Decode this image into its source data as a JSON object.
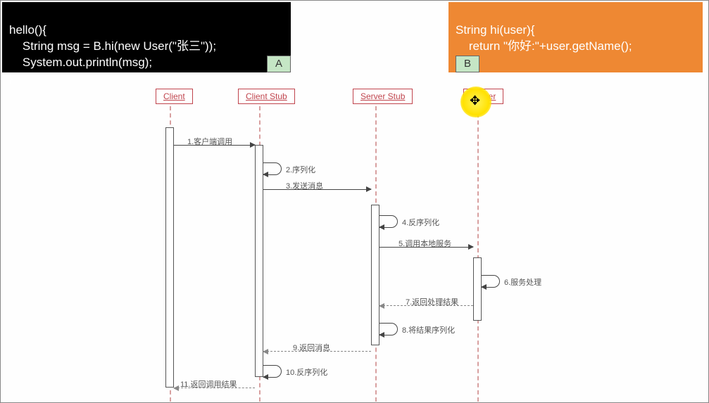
{
  "codeA": {
    "l1": "hello(){",
    "l2": "    String msg = B.hi(new User(\"张三\"));",
    "l3": "    System.out.println(msg);",
    "l4": "}",
    "label": "A"
  },
  "codeB": {
    "l1": "String hi(user){",
    "l2": "    return \"你好:\"+user.getName();",
    "l3": "}",
    "label": "B"
  },
  "lanes": {
    "client": "Client",
    "clientStub": "Client Stub",
    "serverStub": "Server Stub",
    "server": "Server"
  },
  "messages": {
    "m1": "1.客户端调用",
    "m2": "2.序列化",
    "m3": "3.发送消息",
    "m4": "4.反序列化",
    "m5": "5.调用本地服务",
    "m6": "6.服务处理",
    "m7": "7.返回处理结果",
    "m8": "8.将结果序列化",
    "m9": "9.返回消息",
    "m10": "10.反序列化",
    "m11": "11.返回调用结果"
  },
  "chart_data": {
    "type": "sequence-diagram",
    "participants": [
      "Client",
      "Client Stub",
      "Server Stub",
      "Server"
    ],
    "steps": [
      {
        "n": 1,
        "from": "Client",
        "to": "Client Stub",
        "label": "客户端调用",
        "kind": "call"
      },
      {
        "n": 2,
        "from": "Client Stub",
        "to": "Client Stub",
        "label": "序列化",
        "kind": "self"
      },
      {
        "n": 3,
        "from": "Client Stub",
        "to": "Server Stub",
        "label": "发送消息",
        "kind": "call"
      },
      {
        "n": 4,
        "from": "Server Stub",
        "to": "Server Stub",
        "label": "反序列化",
        "kind": "self"
      },
      {
        "n": 5,
        "from": "Server Stub",
        "to": "Server",
        "label": "调用本地服务",
        "kind": "call"
      },
      {
        "n": 6,
        "from": "Server",
        "to": "Server",
        "label": "服务处理",
        "kind": "self"
      },
      {
        "n": 7,
        "from": "Server",
        "to": "Server Stub",
        "label": "返回处理结果",
        "kind": "return"
      },
      {
        "n": 8,
        "from": "Server Stub",
        "to": "Server Stub",
        "label": "将结果序列化",
        "kind": "self"
      },
      {
        "n": 9,
        "from": "Server Stub",
        "to": "Client Stub",
        "label": "返回消息",
        "kind": "return"
      },
      {
        "n": 10,
        "from": "Client Stub",
        "to": "Client Stub",
        "label": "反序列化",
        "kind": "self"
      },
      {
        "n": 11,
        "from": "Client Stub",
        "to": "Client",
        "label": "返回调用结果",
        "kind": "return"
      }
    ]
  }
}
